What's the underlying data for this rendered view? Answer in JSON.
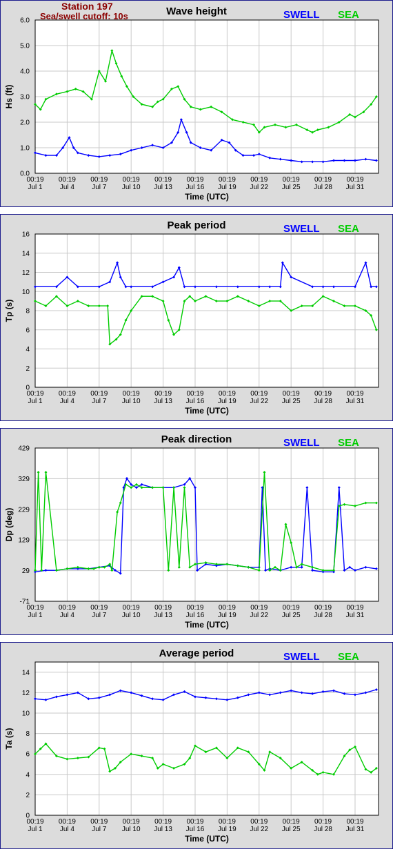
{
  "header": {
    "station": "Station 197",
    "cutoff": "Sea/swell cutoff: 10s"
  },
  "legend": {
    "swell_label": "SWELL",
    "sea_label": "SEA"
  },
  "colors": {
    "swell": "#0000ff",
    "sea": "#00cc00",
    "header": "#8b0000"
  },
  "chart_data": [
    {
      "type": "line",
      "title": "Wave height",
      "ylabel": "Hs (ft)",
      "xlabel": "Time (UTC)",
      "ylim": [
        0,
        6
      ],
      "yticks": [
        "0.0",
        "1.0",
        "2.0",
        "3.0",
        "4.0",
        "5.0",
        "6.0"
      ],
      "x_tick_labels": [
        [
          "00:19",
          "Jul 1"
        ],
        [
          "00:19",
          "Jul 4"
        ],
        [
          "00:19",
          "Jul 7"
        ],
        [
          "00:19",
          "Jul 10"
        ],
        [
          "00:19",
          "Jul 13"
        ],
        [
          "00:19",
          "Jul 16"
        ],
        [
          "00:19",
          "Jul 19"
        ],
        [
          "00:19",
          "Jul 22"
        ],
        [
          "00:19",
          "Jul 25"
        ],
        [
          "00:19",
          "Jul 28"
        ],
        [
          "00:19",
          "Jul 31"
        ]
      ],
      "x_day_range": [
        1,
        33.2
      ],
      "series": [
        {
          "name": "SWELL",
          "x": [
            1,
            2,
            3,
            3.6,
            4.2,
            4.6,
            5,
            6,
            7,
            8,
            9,
            10,
            11,
            12,
            13,
            13.8,
            14.4,
            14.7,
            15.2,
            15.6,
            16.5,
            17.5,
            18.5,
            19.2,
            19.8,
            20.5,
            21.5,
            22,
            23,
            24,
            25,
            26,
            27,
            28,
            29,
            30,
            31,
            32,
            33
          ],
          "y": [
            0.8,
            0.7,
            0.7,
            1.0,
            1.4,
            1.0,
            0.8,
            0.7,
            0.65,
            0.7,
            0.75,
            0.9,
            1.0,
            1.1,
            1.0,
            1.2,
            1.6,
            2.1,
            1.6,
            1.2,
            1.0,
            0.9,
            1.3,
            1.2,
            0.9,
            0.7,
            0.7,
            0.75,
            0.6,
            0.55,
            0.5,
            0.45,
            0.45,
            0.45,
            0.5,
            0.5,
            0.5,
            0.55,
            0.5
          ]
        },
        {
          "name": "SEA",
          "x": [
            1,
            1.5,
            2,
            3,
            4,
            4.8,
            5.5,
            6.3,
            7,
            7.6,
            8.2,
            8.6,
            9.1,
            9.6,
            10.2,
            11,
            12,
            12.5,
            13,
            13.8,
            14.4,
            15,
            15.6,
            16.5,
            17.5,
            18.5,
            19.5,
            20.5,
            21.5,
            22,
            22.5,
            23.5,
            24.5,
            25.5,
            26.5,
            27,
            27.5,
            28.5,
            29.5,
            30.5,
            31,
            31.8,
            32.5,
            33
          ],
          "y": [
            2.7,
            2.5,
            2.9,
            3.1,
            3.2,
            3.3,
            3.2,
            2.9,
            4.0,
            3.6,
            4.8,
            4.3,
            3.8,
            3.4,
            3.0,
            2.7,
            2.6,
            2.8,
            2.9,
            3.3,
            3.4,
            2.9,
            2.6,
            2.5,
            2.6,
            2.4,
            2.1,
            2.0,
            1.9,
            1.6,
            1.8,
            1.9,
            1.8,
            1.9,
            1.7,
            1.6,
            1.7,
            1.8,
            2.0,
            2.3,
            2.2,
            2.4,
            2.7,
            3.0
          ]
        }
      ]
    },
    {
      "type": "line",
      "title": "Peak period",
      "ylabel": "Tp (s)",
      "xlabel": "Time (UTC)",
      "ylim": [
        0,
        16
      ],
      "yticks": [
        "0",
        "2",
        "4",
        "6",
        "8",
        "10",
        "12",
        "14",
        "16"
      ],
      "x_tick_labels": [
        [
          "00:19",
          "Jul 1"
        ],
        [
          "00:19",
          "Jul 4"
        ],
        [
          "00:19",
          "Jul 7"
        ],
        [
          "00:19",
          "Jul 10"
        ],
        [
          "00:19",
          "Jul 13"
        ],
        [
          "00:19",
          "Jul 16"
        ],
        [
          "00:19",
          "Jul 19"
        ],
        [
          "00:19",
          "Jul 22"
        ],
        [
          "00:19",
          "Jul 25"
        ],
        [
          "00:19",
          "Jul 28"
        ],
        [
          "00:19",
          "Jul 31"
        ]
      ],
      "x_day_range": [
        1,
        33.2
      ],
      "series": [
        {
          "name": "SWELL",
          "x": [
            1,
            3,
            4,
            5,
            7,
            8,
            8.7,
            9,
            9.5,
            10,
            12,
            13,
            14,
            14.5,
            15,
            16,
            18,
            20,
            22,
            23,
            24,
            24.2,
            25,
            27,
            28,
            29,
            31,
            32,
            32.5,
            33
          ],
          "y": [
            10.5,
            10.5,
            11.5,
            10.5,
            10.5,
            11.0,
            13.0,
            11.5,
            10.5,
            10.5,
            10.5,
            11.0,
            11.5,
            12.5,
            10.5,
            10.5,
            10.5,
            10.5,
            10.5,
            10.5,
            10.5,
            13.0,
            11.5,
            10.5,
            10.5,
            10.5,
            10.5,
            13.0,
            10.5,
            10.5
          ]
        },
        {
          "name": "SEA",
          "x": [
            1,
            2,
            3,
            4,
            5,
            6,
            7,
            7.8,
            8,
            8.6,
            9,
            9.5,
            10,
            11,
            12,
            13,
            13.5,
            14,
            14.5,
            15,
            15.5,
            16,
            17,
            18,
            19,
            20,
            21,
            22,
            23,
            24,
            25,
            26,
            27,
            28,
            29,
            30,
            31,
            32,
            32.5,
            33
          ],
          "y": [
            9.0,
            8.5,
            9.5,
            8.5,
            9.0,
            8.5,
            8.5,
            8.5,
            4.5,
            5.0,
            5.5,
            7.0,
            8.0,
            9.5,
            9.5,
            9.0,
            7.0,
            5.5,
            6.0,
            9.0,
            9.5,
            9.0,
            9.5,
            9.0,
            9.0,
            9.5,
            9.0,
            8.5,
            9.0,
            9.0,
            8.0,
            8.5,
            8.5,
            9.5,
            9.0,
            8.5,
            8.5,
            8.0,
            7.5,
            6.0
          ]
        }
      ]
    },
    {
      "type": "line",
      "title": "Peak direction",
      "ylabel": "Dp (deg)",
      "xlabel": "Time (UTC)",
      "ylim": [
        -71,
        429
      ],
      "yticks": [
        "-71",
        "29",
        "129",
        "229",
        "329",
        "429"
      ],
      "x_tick_labels": [
        [
          "00:19",
          "Jul 1"
        ],
        [
          "00:19",
          "Jul 4"
        ],
        [
          "00:19",
          "Jul 7"
        ],
        [
          "00:19",
          "Jul 10"
        ],
        [
          "00:19",
          "Jul 13"
        ],
        [
          "00:19",
          "Jul 16"
        ],
        [
          "00:19",
          "Jul 19"
        ],
        [
          "00:19",
          "Jul 22"
        ],
        [
          "00:19",
          "Jul 25"
        ],
        [
          "00:19",
          "Jul 28"
        ],
        [
          "00:19",
          "Jul 31"
        ]
      ],
      "x_day_range": [
        1,
        33.2
      ],
      "series": [
        {
          "name": "SWELL",
          "x": [
            1,
            2,
            3,
            4,
            5,
            6,
            7,
            8,
            8.5,
            9,
            9.3,
            9.6,
            10,
            10.5,
            11,
            12,
            13,
            14,
            15,
            15.5,
            16,
            16.2,
            17,
            18,
            19,
            20,
            21,
            22,
            22.3,
            22.6,
            23,
            24,
            25,
            26,
            26.5,
            27,
            28,
            29,
            29.5,
            30,
            30.5,
            31,
            32,
            33
          ],
          "y": [
            25,
            30,
            30,
            35,
            35,
            35,
            40,
            45,
            30,
            20,
            300,
            330,
            310,
            300,
            310,
            300,
            300,
            300,
            310,
            330,
            300,
            30,
            50,
            45,
            50,
            45,
            40,
            40,
            300,
            30,
            35,
            30,
            40,
            40,
            300,
            30,
            25,
            25,
            300,
            30,
            40,
            30,
            40,
            35
          ]
        },
        {
          "name": "SEA",
          "x": [
            1,
            1.3,
            1.6,
            2,
            3,
            4,
            5,
            6,
            6.5,
            7,
            7.5,
            8,
            8.2,
            8.7,
            9,
            9.5,
            10,
            10.5,
            11,
            12,
            13,
            13.5,
            14,
            14.5,
            15,
            15.5,
            16,
            17,
            18,
            19,
            20,
            21,
            22,
            22.5,
            23,
            23.5,
            24,
            24.5,
            25,
            25.5,
            26,
            27,
            28,
            29,
            29.5,
            30,
            31,
            32,
            33
          ],
          "y": [
            30,
            350,
            30,
            350,
            30,
            35,
            40,
            35,
            35,
            40,
            40,
            50,
            30,
            220,
            250,
            310,
            300,
            310,
            300,
            300,
            300,
            30,
            300,
            40,
            300,
            40,
            50,
            55,
            50,
            50,
            45,
            40,
            30,
            350,
            30,
            40,
            30,
            180,
            120,
            40,
            50,
            40,
            30,
            30,
            240,
            245,
            240,
            250,
            250
          ]
        }
      ]
    },
    {
      "type": "line",
      "title": "Average period",
      "ylabel": "Ta (s)",
      "xlabel": "Time (UTC)",
      "ylim": [
        0,
        15
      ],
      "yticks": [
        "0",
        "2",
        "4",
        "6",
        "8",
        "10",
        "12",
        "14"
      ],
      "x_tick_labels": [
        [
          "00:19",
          "Jul 1"
        ],
        [
          "00:19",
          "Jul 4"
        ],
        [
          "00:19",
          "Jul 7"
        ],
        [
          "00:19",
          "Jul 10"
        ],
        [
          "00:19",
          "Jul 13"
        ],
        [
          "00:19",
          "Jul 16"
        ],
        [
          "00:19",
          "Jul 19"
        ],
        [
          "00:19",
          "Jul 22"
        ],
        [
          "00:19",
          "Jul 25"
        ],
        [
          "00:19",
          "Jul 28"
        ],
        [
          "00:19",
          "Jul 31"
        ]
      ],
      "x_day_range": [
        1,
        33.2
      ],
      "series": [
        {
          "name": "SWELL",
          "x": [
            1,
            2,
            3,
            4,
            5,
            6,
            7,
            8,
            9,
            10,
            11,
            12,
            13,
            14,
            15,
            16,
            17,
            18,
            19,
            20,
            21,
            22,
            23,
            24,
            25,
            26,
            27,
            28,
            29,
            30,
            31,
            32,
            33
          ],
          "y": [
            11.4,
            11.3,
            11.6,
            11.8,
            12.0,
            11.4,
            11.5,
            11.8,
            12.2,
            12.0,
            11.7,
            11.4,
            11.3,
            11.8,
            12.1,
            11.6,
            11.5,
            11.4,
            11.3,
            11.5,
            11.8,
            12.0,
            11.8,
            12.0,
            12.2,
            12.0,
            11.9,
            12.1,
            12.2,
            11.9,
            11.8,
            12.0,
            12.3
          ]
        },
        {
          "name": "SEA",
          "x": [
            1,
            1.5,
            2,
            3,
            4,
            5,
            6,
            7,
            7.5,
            8,
            8.5,
            9,
            10,
            11,
            12,
            12.5,
            13,
            14,
            15,
            15.5,
            16,
            17,
            18,
            19,
            20,
            21,
            22,
            22.5,
            23,
            24,
            25,
            26,
            27,
            27.5,
            28,
            29,
            30,
            30.5,
            31,
            32,
            32.5,
            33
          ],
          "y": [
            6.0,
            6.5,
            7.0,
            5.8,
            5.5,
            5.6,
            5.7,
            6.6,
            6.5,
            4.3,
            4.6,
            5.2,
            6.0,
            5.8,
            5.6,
            4.6,
            5.0,
            4.6,
            5.0,
            5.6,
            6.8,
            6.2,
            6.6,
            5.6,
            6.6,
            6.2,
            5.0,
            4.4,
            6.2,
            5.6,
            4.6,
            5.2,
            4.4,
            4.0,
            4.2,
            4.0,
            5.8,
            6.4,
            6.7,
            4.5,
            4.2,
            4.6
          ]
        }
      ]
    }
  ]
}
